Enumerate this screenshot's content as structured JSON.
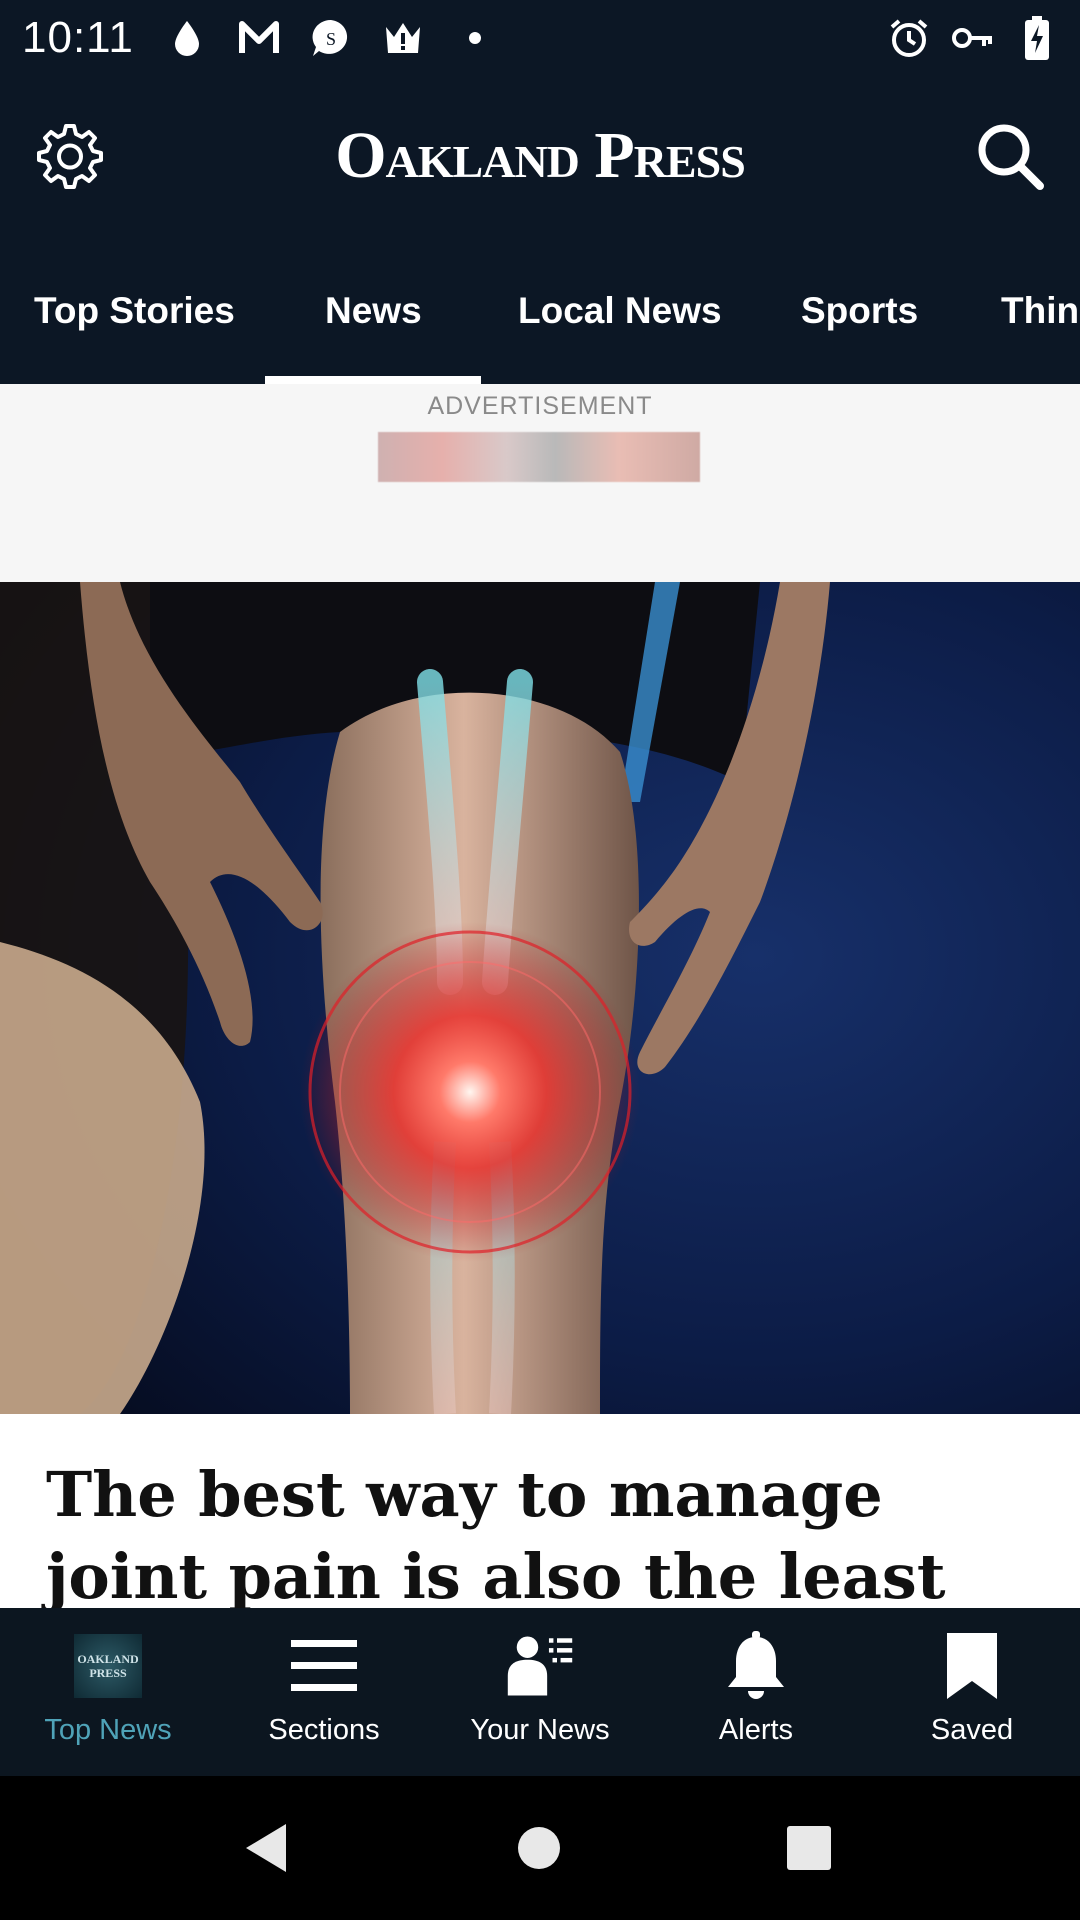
{
  "status_bar": {
    "time": "10:11",
    "left_icons": [
      "drop-icon",
      "gmail-icon",
      "s-chat-icon",
      "crown-alert-icon",
      "dot-icon"
    ],
    "right_icons": [
      "alarm-icon",
      "vpn-key-icon",
      "battery-charging-icon"
    ]
  },
  "header": {
    "logo_text": "Oakland Press",
    "settings_icon": "gear-icon",
    "search_icon": "search-icon"
  },
  "tabs": {
    "items": [
      {
        "label": "Top Stories",
        "active": false
      },
      {
        "label": "News",
        "active": true
      },
      {
        "label": "Local News",
        "active": false
      },
      {
        "label": "Sports",
        "active": false
      },
      {
        "label": "Thin",
        "active": false
      }
    ]
  },
  "ad": {
    "label": "ADVERTISEMENT"
  },
  "article": {
    "headline": "The best way to manage joint pain is also the least intuitive:"
  },
  "bottom_nav": {
    "items": [
      {
        "label": "Top News",
        "icon": "oakland-press-logo-icon",
        "active": true
      },
      {
        "label": "Sections",
        "icon": "hamburger-icon",
        "active": false
      },
      {
        "label": "Your News",
        "icon": "person-list-icon",
        "active": false
      },
      {
        "label": "Alerts",
        "icon": "bell-icon",
        "active": false
      },
      {
        "label": "Saved",
        "icon": "bookmark-icon",
        "active": false
      }
    ]
  },
  "colors": {
    "header_bg": "#0c1725",
    "active_nav": "#4fa3b8",
    "ad_bg": "#f6f6f6"
  }
}
